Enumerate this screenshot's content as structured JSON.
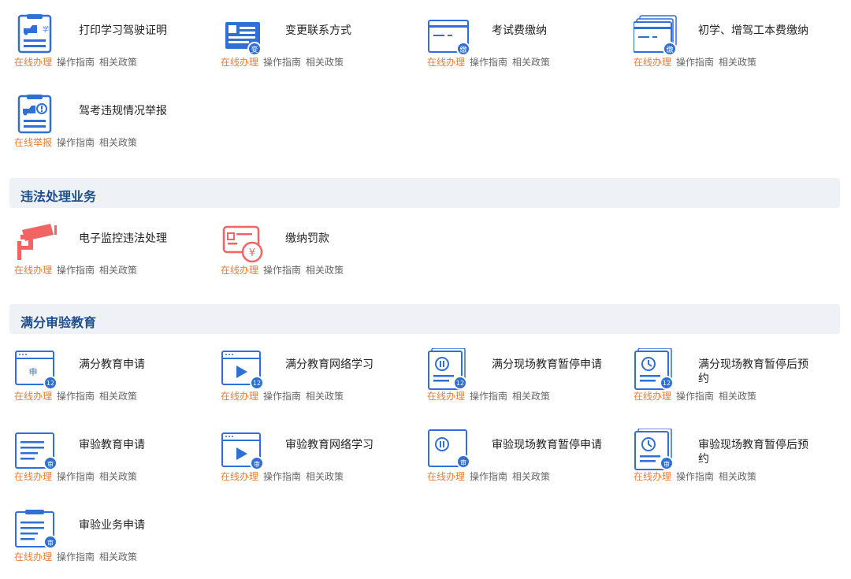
{
  "link_labels": {
    "online": "在线办理",
    "report": "在线举报",
    "guide": "操作指南",
    "policy": "相关政策"
  },
  "colors": {
    "icon_blue": "#2f6fd6",
    "accent_orange": "#f07a30",
    "accent_red": "#f06464",
    "section_bg": "#eef2f7",
    "section_text": "#1f4e8c"
  },
  "top": {
    "items": [
      {
        "title": "打印学习驾驶证明",
        "icon": "print-study-certificate-icon",
        "badge": "学",
        "online": "在线办理",
        "guide": "操作指南",
        "policy": "相关政策"
      },
      {
        "title": "变更联系方式",
        "icon": "change-contact-icon",
        "badge": "变",
        "online": "在线办理",
        "guide": "操作指南",
        "policy": "相关政策"
      },
      {
        "title": "考试费缴纳",
        "icon": "exam-fee-icon",
        "badge": "缴",
        "online": "在线办理",
        "guide": "操作指南",
        "policy": "相关政策"
      },
      {
        "title": "初学、增驾工本费缴纳",
        "icon": "license-fee-icon",
        "badge": "缴",
        "online": "在线办理",
        "guide": "操作指南",
        "policy": "相关政策"
      },
      {
        "title": "驾考违规情况举报",
        "icon": "exam-violation-report-icon",
        "online": "在线举报",
        "guide": "操作指南",
        "policy": "相关政策"
      }
    ]
  },
  "violation": {
    "header": "违法处理业务",
    "items": [
      {
        "title": "电子监控违法处理",
        "icon": "surveillance-camera-icon",
        "online": "在线办理",
        "guide": "操作指南",
        "policy": "相关政策"
      },
      {
        "title": "缴纳罚款",
        "icon": "pay-fine-icon",
        "badge": "¥",
        "online": "在线办理",
        "guide": "操作指南",
        "policy": "相关政策"
      }
    ]
  },
  "education": {
    "header": "满分审验教育",
    "items": [
      {
        "title": "满分教育申请",
        "icon": "full-score-apply-icon",
        "badge": "12",
        "inner": "申",
        "online": "在线办理",
        "guide": "操作指南",
        "policy": "相关政策"
      },
      {
        "title": "满分教育网络学习",
        "icon": "full-score-online-study-icon",
        "badge": "12",
        "online": "在线办理",
        "guide": "操作指南",
        "policy": "相关政策"
      },
      {
        "title": "满分现场教育暂停申请",
        "icon": "full-score-onsite-pause-icon",
        "badge": "12",
        "online": "在线办理",
        "guide": "操作指南",
        "policy": "相关政策"
      },
      {
        "title": "满分现场教育暂停后预约",
        "icon": "full-score-onsite-appointment-icon",
        "badge": "12",
        "online": "在线办理",
        "guide": "操作指南",
        "policy": "相关政策"
      },
      {
        "title": "审验教育申请",
        "icon": "review-apply-icon",
        "badge": "审",
        "online": "在线办理",
        "guide": "操作指南",
        "policy": "相关政策"
      },
      {
        "title": "审验教育网络学习",
        "icon": "review-online-study-icon",
        "badge": "审",
        "online": "在线办理",
        "guide": "操作指南",
        "policy": "相关政策"
      },
      {
        "title": "审验现场教育暂停申请",
        "icon": "review-onsite-pause-icon",
        "badge": "审",
        "online": "在线办理",
        "guide": "操作指南",
        "policy": "相关政策"
      },
      {
        "title": "审验现场教育暂停后预约",
        "icon": "review-onsite-appointment-icon",
        "badge": "审",
        "online": "在线办理",
        "guide": "操作指南",
        "policy": "相关政策"
      },
      {
        "title": "审验业务申请",
        "icon": "review-business-apply-icon",
        "badge": "审",
        "online": "在线办理",
        "guide": "操作指南",
        "policy": "相关政策"
      }
    ]
  }
}
